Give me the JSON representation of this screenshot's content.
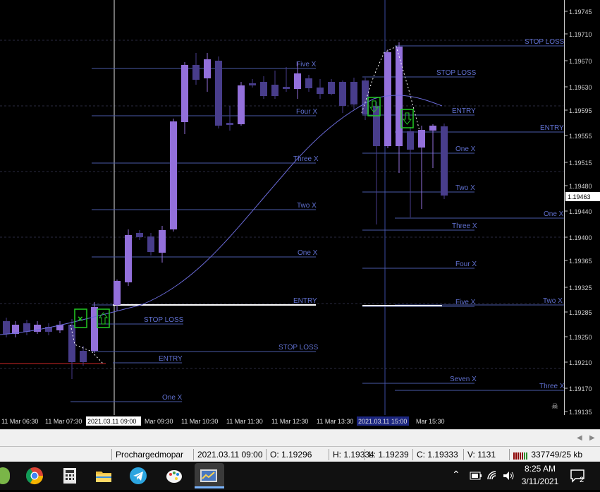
{
  "chart": {
    "colors": {
      "background": "#000000",
      "bull_candle": "#9370db",
      "bear_candle": "#483d8b",
      "level_line": "#4a5aa8",
      "level_text": "#6070d0",
      "ma_line": "#6a6ad8",
      "entry_line": "#ffffff",
      "signal_box": "#22cc22",
      "red_line": "#8b1a1a"
    },
    "price_axis": {
      "labels": [
        "1.19745",
        "1.19710",
        "1.19670",
        "1.19630",
        "1.19595",
        "1.19555",
        "1.19515",
        "1.19480",
        "1.19440",
        "1.19400",
        "1.19365",
        "1.19325",
        "1.19285",
        "1.19250",
        "1.19210",
        "1.19170",
        "1.19135"
      ],
      "current_price": "1.19463"
    },
    "time_axis": {
      "labels": [
        "11 Mar 06:30",
        "11 Mar 07:30",
        "2021.03.11 09:00",
        "Mar 09:30",
        "11 Mar 10:30",
        "11 Mar 11:30",
        "11 Mar 12:30",
        "11 Mar 13:30",
        "2021.03.11 15:00",
        "Mar 15:30"
      ]
    },
    "levels": {
      "left": [
        {
          "label": "Five X"
        },
        {
          "label": "Four X"
        },
        {
          "label": "Three X"
        },
        {
          "label": "Two X"
        },
        {
          "label": "One X"
        },
        {
          "label": "ENTRY"
        },
        {
          "label": "STOP LOSS"
        },
        {
          "label": "STOP LOSS"
        },
        {
          "label": "ENTRY"
        },
        {
          "label": "One X"
        }
      ],
      "middle": [
        {
          "label": "STOP LOSS"
        },
        {
          "label": "ENTRY"
        },
        {
          "label": "One X"
        },
        {
          "label": "Two X"
        },
        {
          "label": "Three X"
        },
        {
          "label": "Four X"
        },
        {
          "label": "Five X"
        },
        {
          "label": "Seven X"
        }
      ],
      "right": [
        {
          "label": "STOP LOSS"
        },
        {
          "label": "ENTRY"
        },
        {
          "label": "One X"
        },
        {
          "label": "Two X"
        },
        {
          "label": "Three X"
        }
      ]
    }
  },
  "status_bar": {
    "profile": "Prochargedmopar",
    "time": "2021.03.11 09:00",
    "open": "O: 1.19296",
    "high": "H: 1.19334",
    "low": "L: 1.19239",
    "close": "C: 1.19333",
    "volume": "V: 1131",
    "traffic": "337749/25 kb"
  },
  "taskbar": {
    "apps": [
      "chrome-icon",
      "calculator-icon",
      "file-explorer-icon",
      "telegram-icon",
      "paint-icon",
      "trading-terminal-icon"
    ],
    "clock_time": "8:25 AM",
    "clock_date": "3/11/2021",
    "notification_count": "2"
  }
}
